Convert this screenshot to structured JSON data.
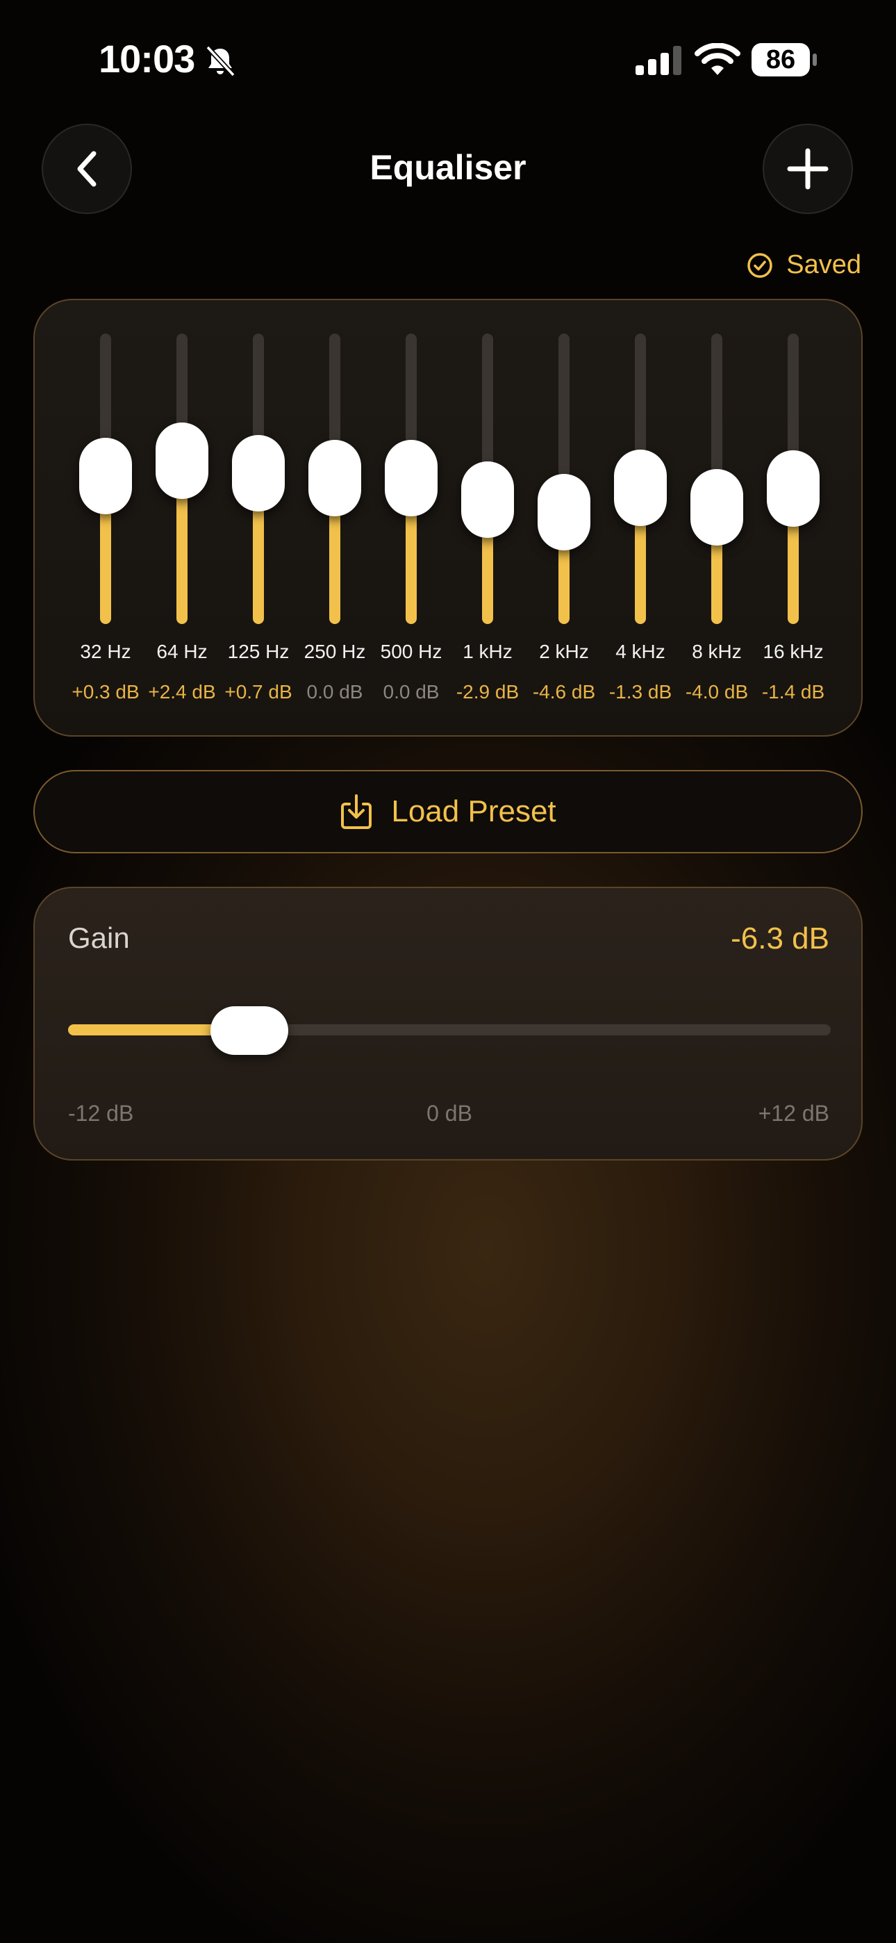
{
  "status_bar": {
    "time": "10:03",
    "battery": "86"
  },
  "header": {
    "title": "Equaliser"
  },
  "saved_label": "Saved",
  "equalizer": {
    "range_db": [
      -12,
      12
    ],
    "bands": [
      {
        "freq": "32 Hz",
        "db_label": "+0.3 dB",
        "db": 0.3
      },
      {
        "freq": "64 Hz",
        "db_label": "+2.4 dB",
        "db": 2.4
      },
      {
        "freq": "125 Hz",
        "db_label": "+0.7 dB",
        "db": 0.7
      },
      {
        "freq": "250 Hz",
        "db_label": "0.0 dB",
        "db": 0.0
      },
      {
        "freq": "500 Hz",
        "db_label": "0.0 dB",
        "db": 0.0
      },
      {
        "freq": "1 kHz",
        "db_label": "-2.9 dB",
        "db": -2.9
      },
      {
        "freq": "2 kHz",
        "db_label": "-4.6 dB",
        "db": -4.6
      },
      {
        "freq": "4 kHz",
        "db_label": "-1.3 dB",
        "db": -1.3
      },
      {
        "freq": "8 kHz",
        "db_label": "-4.0 dB",
        "db": -4.0
      },
      {
        "freq": "16 kHz",
        "db_label": "-1.4 dB",
        "db": -1.4
      }
    ]
  },
  "load_preset": {
    "label": "Load Preset"
  },
  "gain": {
    "label": "Gain",
    "value_label": "-6.3 dB",
    "value": -6.3,
    "min_label": "-12 dB",
    "mid_label": "0 dB",
    "max_label": "+12 dB"
  },
  "colors": {
    "accent": "#f2c14b",
    "background": "#050403"
  }
}
